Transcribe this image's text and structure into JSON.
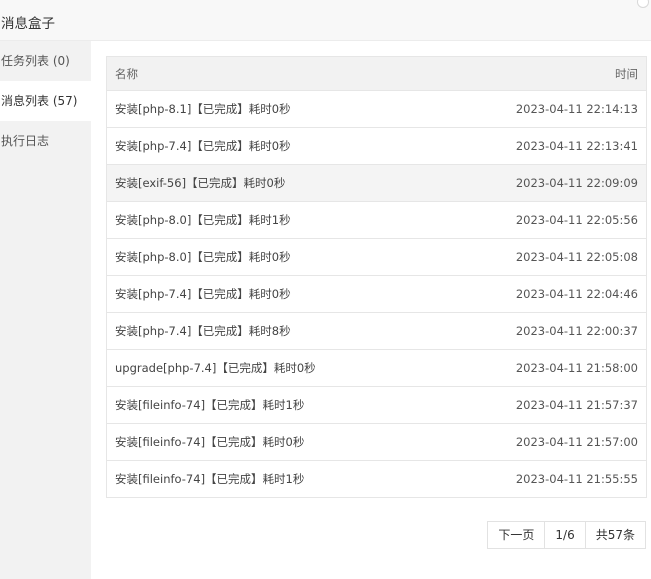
{
  "window": {
    "title": "消息盒子"
  },
  "sidebar": {
    "items": [
      {
        "label": "任务列表 (0)"
      },
      {
        "label": "消息列表 (57)"
      },
      {
        "label": "执行日志"
      }
    ],
    "active_index": 1
  },
  "table": {
    "headers": {
      "name": "名称",
      "time": "时间"
    },
    "rows": [
      {
        "name": "安装[php-8.1]【已完成】耗时0秒",
        "time": "2023-04-11 22:14:13"
      },
      {
        "name": "安装[php-7.4]【已完成】耗时0秒",
        "time": "2023-04-11 22:13:41"
      },
      {
        "name": "安装[exif-56]【已完成】耗时0秒",
        "time": "2023-04-11 22:09:09"
      },
      {
        "name": "安装[php-8.0]【已完成】耗时1秒",
        "time": "2023-04-11 22:05:56"
      },
      {
        "name": "安装[php-8.0]【已完成】耗时0秒",
        "time": "2023-04-11 22:05:08"
      },
      {
        "name": "安装[php-7.4]【已完成】耗时0秒",
        "time": "2023-04-11 22:04:46"
      },
      {
        "name": "安装[php-7.4]【已完成】耗时8秒",
        "time": "2023-04-11 22:00:37"
      },
      {
        "name": "upgrade[php-7.4]【已完成】耗时0秒",
        "time": "2023-04-11 21:58:00"
      },
      {
        "name": "安装[fileinfo-74]【已完成】耗时1秒",
        "time": "2023-04-11 21:57:37"
      },
      {
        "name": "安装[fileinfo-74]【已完成】耗时0秒",
        "time": "2023-04-11 21:57:00"
      },
      {
        "name": "安装[fileinfo-74]【已完成】耗时1秒",
        "time": "2023-04-11 21:55:55"
      }
    ]
  },
  "pagination": {
    "next_label": "下一页",
    "page_indicator": "1/6",
    "total_label": "共57条"
  }
}
